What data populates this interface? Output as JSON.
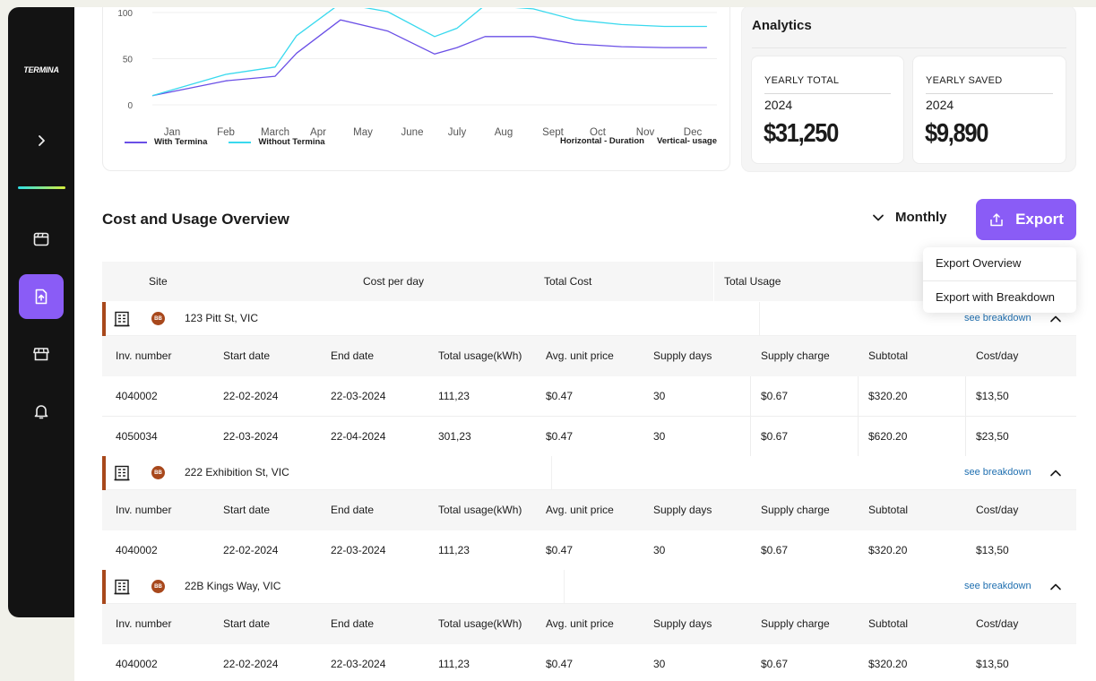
{
  "sidebar": {
    "logo": "TERMINA",
    "items": [
      {
        "icon": "chevron-right-icon"
      },
      {
        "icon": "calendar-icon"
      },
      {
        "icon": "file-upload-icon",
        "active": true
      },
      {
        "icon": "store-icon"
      },
      {
        "icon": "bell-icon"
      }
    ]
  },
  "chart_data": {
    "type": "line",
    "categories": [
      "Jan",
      "Feb",
      "March",
      "Apr",
      "May",
      "June",
      "July",
      "Aug",
      "Sept",
      "Oct",
      "Nov",
      "Dec"
    ],
    "y_ticks": [
      "100",
      "50",
      "0"
    ],
    "ylim": [
      0,
      100
    ],
    "series": [
      {
        "name": "With Termina",
        "color": "#6a4fe6",
        "values": [
          10,
          26,
          31,
          56,
          92,
          80,
          55,
          62,
          74,
          74,
          66,
          63,
          62,
          62
        ]
      },
      {
        "name": "Without Termina",
        "color": "#39d9ee",
        "values": [
          10,
          33,
          41,
          75,
          110,
          101,
          74,
          83,
          108,
          104,
          92,
          87,
          85,
          85
        ]
      }
    ],
    "series_x": [
      0,
      1,
      2,
      2.5,
      3.5,
      4.5,
      5.5,
      6,
      6.6,
      7.6,
      8.5,
      9.5,
      10.4,
      11.3
    ],
    "notes": [
      "Horizontal - Duration",
      "Vertical- usage"
    ]
  },
  "analytics": {
    "title": "Analytics",
    "yearly_total": {
      "label": "YEARLY TOTAL",
      "year": "2024",
      "value": "$31,250"
    },
    "yearly_saved": {
      "label": "YEARLY SAVED",
      "year": "2024",
      "value": "$9,890"
    }
  },
  "overview": {
    "title": "Cost and Usage Overview",
    "period": "Monthly",
    "export_label": "Export",
    "export_menu": [
      "Export Overview",
      "Export with Breakdown"
    ]
  },
  "table": {
    "headers": [
      "Site",
      "Cost per day",
      "Total Cost",
      "Total Usage"
    ],
    "sub_headers": [
      "Inv. number",
      "Start date",
      "End date",
      "Total usage(kWh)",
      "Avg. unit price",
      "Supply days",
      "Supply charge",
      "Subtotal",
      "Cost/day"
    ],
    "see_breakdown": "see breakdown",
    "badge": "BB",
    "sites": [
      {
        "name": "123 Pitt St, VIC",
        "rows": [
          [
            "4040002",
            "22-02-2024",
            "22-03-2024",
            "111,23",
            "$0.47",
            "30",
            "$0.67",
            "$320.20",
            "$13,50"
          ],
          [
            "4050034",
            "22-03-2024",
            "22-04-2024",
            "301,23",
            "$0.47",
            "30",
            "$0.67",
            "$620.20",
            "$23,50"
          ]
        ]
      },
      {
        "name": "222 Exhibition St, VIC",
        "rows": [
          [
            "4040002",
            "22-02-2024",
            "22-03-2024",
            "111,23",
            "$0.47",
            "30",
            "$0.67",
            "$320.20",
            "$13,50"
          ]
        ]
      },
      {
        "name": "22B Kings Way, VIC",
        "rows": [
          [
            "4040002",
            "22-02-2024",
            "22-03-2024",
            "111,23",
            "$0.47",
            "30",
            "$0.67",
            "$320.20",
            "$13,50"
          ]
        ]
      }
    ]
  }
}
